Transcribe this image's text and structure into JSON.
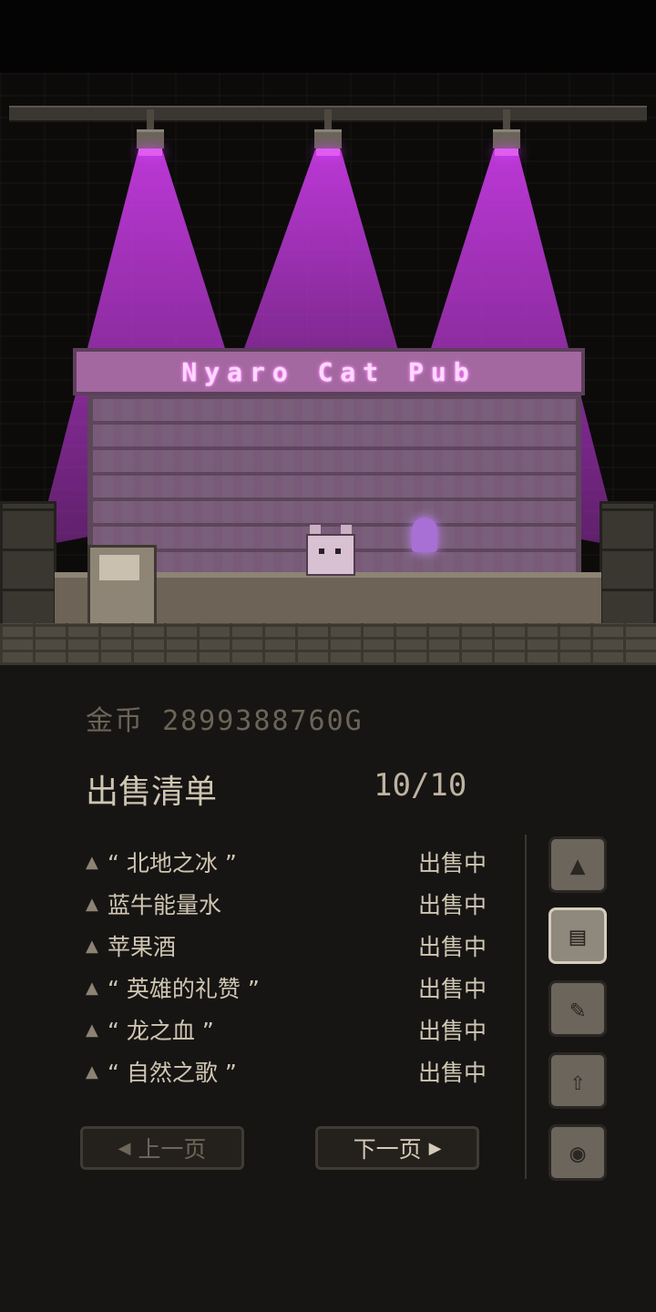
{
  "scene": {
    "sign_text": "Nyaro Cat Pub"
  },
  "status": {
    "gold_label": "金币",
    "gold_value": "28993887​60G"
  },
  "sale_list": {
    "title": "出售清单",
    "counter": "10/10",
    "items": [
      {
        "name": "“ 北地之冰 ”",
        "status": "出售中"
      },
      {
        "name": "蓝牛能量水",
        "status": "出售中"
      },
      {
        "name": "苹果酒",
        "status": "出售中"
      },
      {
        "name": "“ 英雄的礼赞 ”",
        "status": "出售中"
      },
      {
        "name": "“ 龙之血 ”",
        "status": "出售中"
      },
      {
        "name": "“ 自然之歌 ”",
        "status": "出售中"
      }
    ]
  },
  "nav": {
    "prev_label": "上一页",
    "next_label": "下一页"
  },
  "side_icons": [
    "triangle-tab-icon",
    "list-tab-icon",
    "scroll-tab-icon",
    "upgrade-tab-icon",
    "record-tab-icon"
  ],
  "colors": {
    "spotlight": "#c43ae0",
    "text": "#cfc6b3"
  }
}
